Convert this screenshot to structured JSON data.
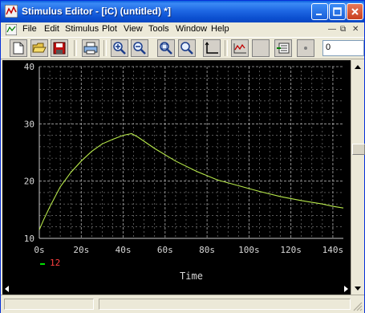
{
  "window": {
    "title": "Stimulus Editor - [iC) (untitled) *]"
  },
  "menu": {
    "items": [
      "File",
      "Edit",
      "Stimulus",
      "Plot",
      "View",
      "Tools",
      "Window",
      "Help"
    ]
  },
  "toolbar": {
    "buttons": [
      "new-icon",
      "open-icon",
      "save-icon",
      "print-icon",
      "zoom-in-icon",
      "zoom-out-icon",
      "zoom-fit-icon",
      "zoom-area-icon",
      "axis-icon",
      "add-trace-icon",
      "blank-icon",
      "edit-stimulus-icon",
      "dot-icon"
    ],
    "zoom_value": "0"
  },
  "colors": {
    "plot_bg": "#000000",
    "grid": "#8a8a8a",
    "axis_text": "#d8d8d8",
    "trace": "#b7e84a",
    "legend_marker": "#00e000",
    "legend_text": "#ff4040"
  },
  "chart_data": {
    "type": "line",
    "xlabel": "Time",
    "ylabel": "",
    "xlim": [
      0,
      145
    ],
    "ylim": [
      10,
      40
    ],
    "x_ticks": [
      "0s",
      "20s",
      "40s",
      "60s",
      "80s",
      "100s",
      "120s",
      "140s"
    ],
    "x_tick_values": [
      0,
      20,
      40,
      60,
      80,
      100,
      120,
      140
    ],
    "y_ticks": [
      "10",
      "20",
      "30",
      "40"
    ],
    "y_tick_values": [
      10,
      20,
      30,
      40
    ],
    "grid": true,
    "legend_position": "bottom-left",
    "series": [
      {
        "name": "12",
        "x": [
          0,
          2,
          5,
          10,
          15,
          20,
          25,
          30,
          35,
          40,
          44,
          47,
          55,
          65,
          75,
          85,
          95,
          105,
          115,
          125,
          135,
          140,
          145
        ],
        "y": [
          11.5,
          13.2,
          15.5,
          19,
          21.5,
          23.5,
          25.2,
          26.5,
          27.3,
          28,
          28.3,
          27.7,
          25.7,
          23.5,
          21.7,
          20.2,
          19.2,
          18.2,
          17.3,
          16.6,
          16,
          15.6,
          15.3
        ]
      }
    ]
  }
}
